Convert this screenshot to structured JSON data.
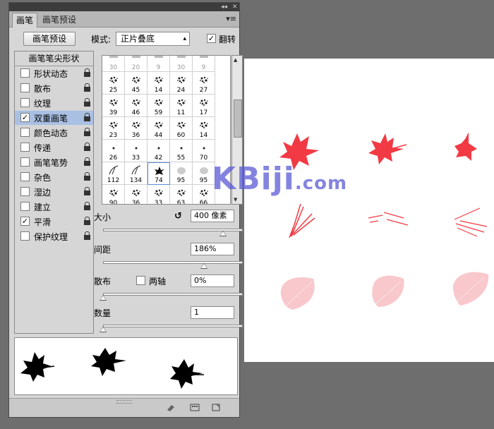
{
  "panel": {
    "tabs": [
      {
        "label": "画笔"
      },
      {
        "label": "画笔预设"
      }
    ],
    "controls_double_arrow": "◂◂",
    "controls_close": "✕",
    "menu_icon": "▾≡"
  },
  "toolbar": {
    "presets_button": "画笔预设",
    "mode_label": "模式:",
    "mode_value": "正片叠底",
    "flip_label": "翻转",
    "flip_checked": true
  },
  "sidebar": {
    "header": "画笔笔尖形状",
    "items": [
      {
        "label": "形状动态",
        "checked": false
      },
      {
        "label": "散布",
        "checked": false
      },
      {
        "label": "纹理",
        "checked": false
      },
      {
        "label": "双重画笔",
        "checked": true,
        "selected": true
      },
      {
        "label": "颜色动态",
        "checked": false
      },
      {
        "label": "传递",
        "checked": false
      },
      {
        "label": "画笔笔势",
        "checked": false
      },
      {
        "label": "杂色",
        "checked": false
      },
      {
        "label": "湿边",
        "checked": false
      },
      {
        "label": "建立",
        "checked": false
      },
      {
        "label": "平滑",
        "checked": true
      },
      {
        "label": "保护纹理",
        "checked": false
      }
    ]
  },
  "brush_grid": {
    "rows": [
      [
        "30",
        "20",
        "9",
        "30",
        "9"
      ],
      [
        "25",
        "45",
        "14",
        "24",
        "27"
      ],
      [
        "39",
        "46",
        "59",
        "11",
        "17"
      ],
      [
        "23",
        "36",
        "44",
        "60",
        "14"
      ],
      [
        "26",
        "33",
        "42",
        "55",
        "70"
      ],
      [
        "112",
        "134",
        "74",
        "95",
        "95"
      ],
      [
        "90",
        "36",
        "33",
        "63",
        "66"
      ]
    ],
    "selected": "74"
  },
  "settings": {
    "size_label": "大小",
    "size_value": "400 像素",
    "size_fraction": 0.86,
    "spacing_label": "间距",
    "spacing_value": "186%",
    "spacing_fraction": 0.72,
    "scatter_label": "散布",
    "both_axes_label": "两轴",
    "scatter_value": "0%",
    "scatter_fraction": 0.0,
    "count_label": "数量",
    "count_value": "1",
    "count_fraction": 0.0
  },
  "watermark": {
    "text": "KBiji",
    "suffix": ".com"
  },
  "colors": {
    "accent_red": "#f23a44",
    "leaf_pink": "#f8c8cc",
    "selection_blue": "#a9c0e3",
    "watermark_blue": "#5b5bd6"
  }
}
